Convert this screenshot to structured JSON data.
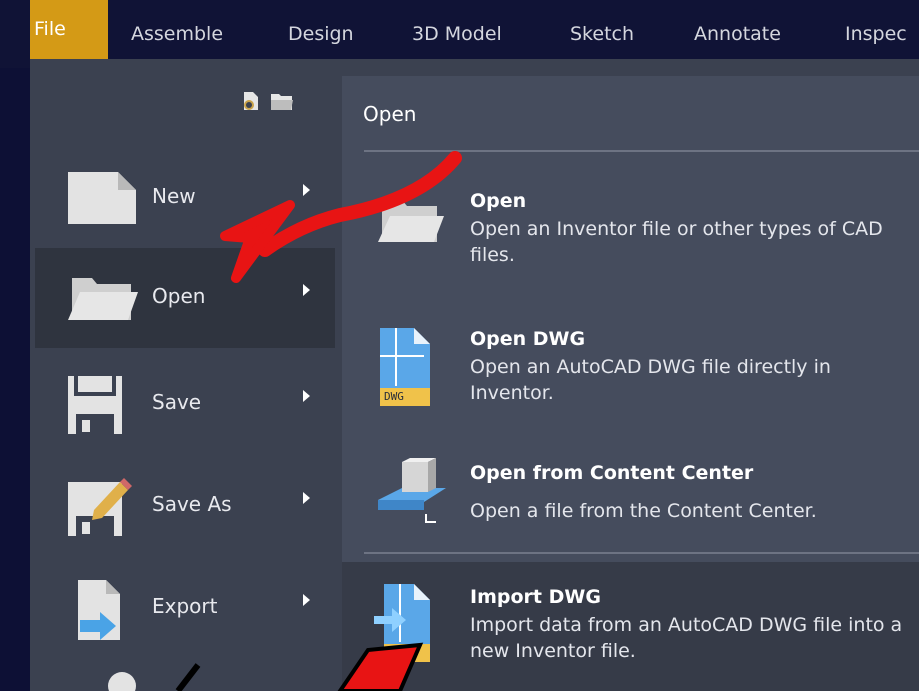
{
  "ribbon": {
    "tabs": [
      "File",
      "Assemble",
      "Design",
      "3D Model",
      "Sketch",
      "Annotate",
      "Inspec"
    ]
  },
  "menu": {
    "items": [
      {
        "label": "New",
        "icon": "new-document-icon"
      },
      {
        "label": "Open",
        "icon": "folder-open-icon"
      },
      {
        "label": "Save",
        "icon": "floppy-disk-icon"
      },
      {
        "label": "Save As",
        "icon": "save-as-pencil-icon"
      },
      {
        "label": "Export",
        "icon": "export-arrow-icon"
      }
    ],
    "active_item": "Open"
  },
  "panel": {
    "title": "Open",
    "entries": [
      {
        "title": "Open",
        "description": "Open an Inventor file or other types of CAD files."
      },
      {
        "title": "Open DWG",
        "description": "Open an AutoCAD DWG file directly in Inventor.",
        "badge": "DWG"
      },
      {
        "title": "Open from Content Center",
        "description": "Open a file from the Content Center."
      },
      {
        "title": "Import DWG",
        "description": "Import data from an AutoCAD DWG file into a new Inventor file."
      }
    ]
  },
  "colors": {
    "file_tab": "#d49a16",
    "menu_bg": "#3b4150",
    "panel_bg": "#454c5d",
    "annotation_arrow": "#e81414"
  }
}
